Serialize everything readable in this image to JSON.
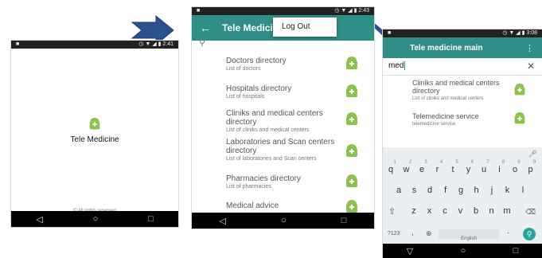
{
  "screen1": {
    "status_icon": "android-notification-icon",
    "status_time": "2:41",
    "app_name": "Tele Medicine",
    "footer": "© All rights reserved"
  },
  "screen2": {
    "status_time": "2:43",
    "toolbar_title": "Tele Medicine",
    "menu_item": "Log Out",
    "items": [
      {
        "title": "Doctors directory",
        "subtitle": "List of doctors"
      },
      {
        "title": "Hospitals directory",
        "subtitle": "List of hospitals"
      },
      {
        "title": "Cliniks and medical centers directory",
        "subtitle": "List of cliniks and medical centers"
      },
      {
        "title": "Laboratories and Scan centers directory",
        "subtitle": "List of laboratories and Scan centers"
      },
      {
        "title": "Pharmacies directory",
        "subtitle": "List of pharmacies"
      },
      {
        "title": "Medical advice",
        "subtitle": ""
      }
    ]
  },
  "screen3": {
    "status_time": "3:08",
    "toolbar_title": "Tele medicine main",
    "search_value": "med",
    "results": [
      {
        "title": "Cliniks and medical centers directory",
        "subtitle": "List of cliniks and medical centers"
      },
      {
        "title": "Telemedicine service",
        "subtitle": "telemedicine service"
      }
    ],
    "keyboard": {
      "row1": [
        "q",
        "w",
        "e",
        "r",
        "t",
        "y",
        "u",
        "i",
        "o",
        "p"
      ],
      "row1_hints": [
        "1",
        "2",
        "3",
        "4",
        "5",
        "6",
        "7",
        "8",
        "9",
        "0"
      ],
      "row2": [
        "a",
        "s",
        "d",
        "f",
        "g",
        "h",
        "j",
        "k",
        "l"
      ],
      "row3": [
        "z",
        "x",
        "c",
        "v",
        "b",
        "n",
        "m"
      ],
      "symbols_key": "?123",
      "comma_key": ",",
      "space_label": "English",
      "period_key": "."
    }
  },
  "colors": {
    "teal": "#2f8f86",
    "arrow": "#2b4f8f",
    "droid": "#8bc34a"
  }
}
